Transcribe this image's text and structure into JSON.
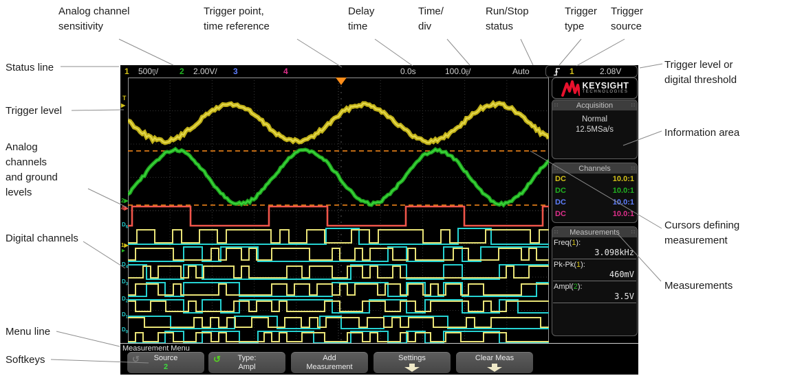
{
  "annotations": [
    {
      "text": "Analog channel\nsensitivity"
    },
    {
      "text": "Trigger point,\ntime reference"
    },
    {
      "text": "Delay\ntime"
    },
    {
      "text": "Time/\ndiv"
    },
    {
      "text": "Run/Stop\nstatus"
    },
    {
      "text": "Trigger\ntype"
    },
    {
      "text": "Trigger\nsource"
    },
    {
      "text": "Status line"
    },
    {
      "text": "Trigger level"
    },
    {
      "text": "Analog\nchannels\nand ground\nlevels"
    },
    {
      "text": "Digital channels"
    },
    {
      "text": "Menu line"
    },
    {
      "text": "Softkeys"
    },
    {
      "text": "Trigger level or\ndigital threshold"
    },
    {
      "text": "Information area"
    },
    {
      "text": "Cursors defining\nmeasurement"
    },
    {
      "text": "Measurements"
    }
  ],
  "status": {
    "ch1": {
      "num": "1",
      "scale": "500",
      "unit": "mV",
      "slash": "/"
    },
    "ch2": {
      "num": "2",
      "scale": "2.00V/"
    },
    "ch3": {
      "num": "3"
    },
    "ch4": {
      "num": "4"
    },
    "delay": "0.0s",
    "timebase": {
      "scale": "100.0",
      "unit": "µs",
      "slash": "/"
    },
    "run_stop": "Auto",
    "trigger": {
      "source": "1",
      "level": "2.08V"
    }
  },
  "gutter": {
    "trigger_t": "T",
    "arrow": "▶",
    "ch2_marker": "2",
    "ch4_marker": "4",
    "ch1_marker": "1",
    "d6": {
      "d": "D",
      "n": "6"
    },
    "d4": {
      "d": "D",
      "n": "4"
    },
    "d3": {
      "d": "D",
      "n": "3"
    },
    "d2": {
      "d": "D",
      "n": "2"
    },
    "d1": {
      "d": "D",
      "n": "1"
    },
    "d0": {
      "d": "D",
      "n": "0"
    }
  },
  "sidebar": {
    "logo": {
      "brand": "KEYSIGHT",
      "sub": "TECHNOLOGIES"
    },
    "acquisition": {
      "title": "Acquisition",
      "mode": "Normal",
      "rate": "12.5MSa/s"
    },
    "channels": {
      "title": "Channels",
      "rows": [
        {
          "coupling": "DC",
          "probe": "10.0:1"
        },
        {
          "coupling": "DC",
          "probe": "10.0:1"
        },
        {
          "coupling": "DC",
          "probe": "10.0:1"
        },
        {
          "coupling": "DC",
          "probe": "10.0:1"
        }
      ]
    },
    "measurements": {
      "title": "Measurements",
      "items": [
        {
          "name": "Freq(",
          "src": "1",
          "close": "):",
          "value": "3.098kHz"
        },
        {
          "name": "Pk-Pk(",
          "src": "1",
          "close": "):",
          "value": "460mV"
        },
        {
          "name": "Ampl(",
          "src": "2",
          "close": "):",
          "value": "3.5V"
        }
      ]
    }
  },
  "menu_line": "Measurement Menu",
  "softkeys": [
    {
      "line1": "Source",
      "line2": "2"
    },
    {
      "line1": "Type:",
      "line2": "Ampl"
    },
    {
      "line1": "Add",
      "line2": "Measurement"
    },
    {
      "line1": "Settings",
      "line2": ""
    },
    {
      "line1": "Clear Meas",
      "line2": ""
    }
  ],
  "colors": {
    "ch1_yellow": "#d4c21a",
    "ch2_green": "#21b321",
    "ch3_blue": "#5f7fff",
    "ch4_magenta": "#e02f8c",
    "red_trace": "#f0554a",
    "cyan_trace": "#25d3d3",
    "digital_yellow": "#e9e377",
    "cursor_orange": "#ff8e1a",
    "keysight_red": "#e8112d"
  }
}
